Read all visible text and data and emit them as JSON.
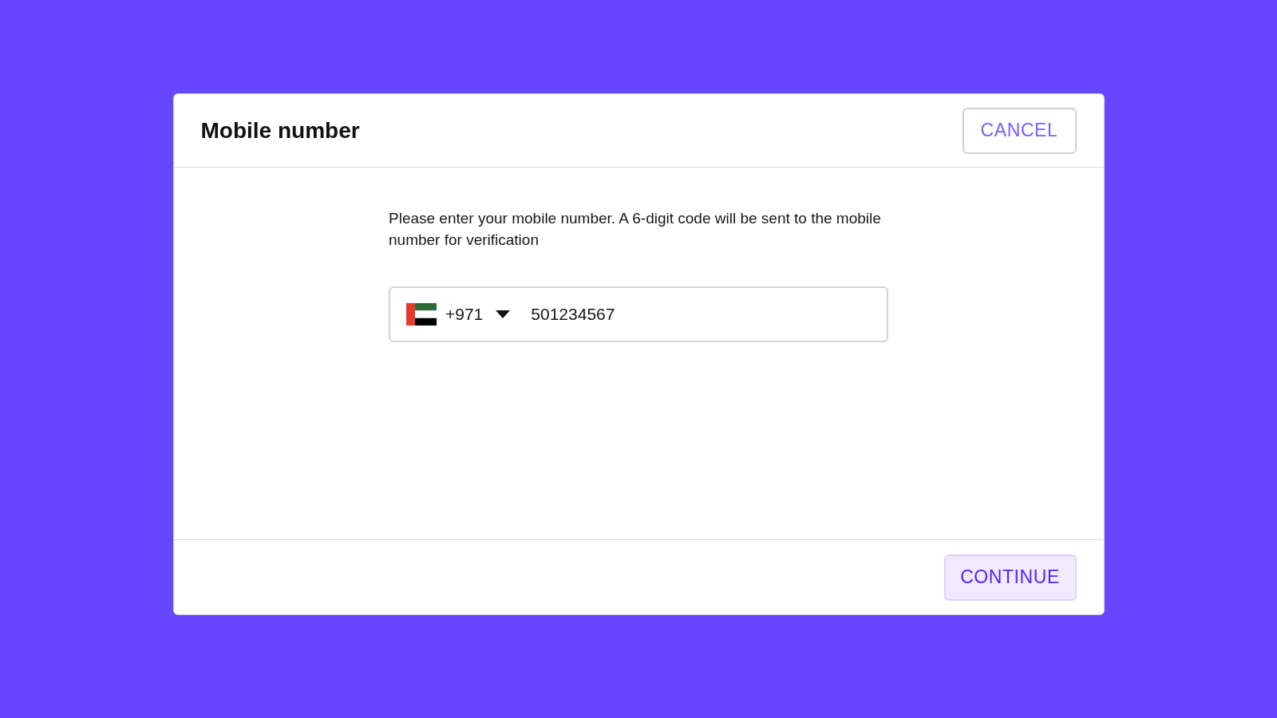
{
  "dialog": {
    "title": "Mobile number",
    "cancel_button": "CANCEL",
    "instruction": "Please enter your mobile number. A 6-digit code will be sent to the mobile number for verification",
    "phone_field": {
      "dial_code": "+971",
      "value": "501234567"
    },
    "continue_button": "CONTINUE"
  }
}
